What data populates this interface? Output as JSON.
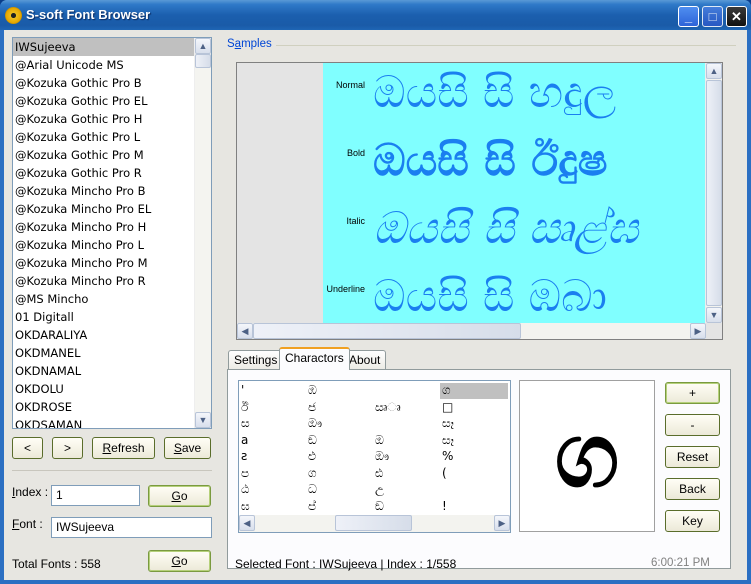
{
  "window": {
    "title": "S-soft Font Browser",
    "icon": "radiation-icon",
    "controls": {
      "minimize": "_",
      "maximize": "□",
      "close": "✕"
    }
  },
  "font_list": {
    "items": [
      "IWSujeeva",
      "@Arial Unicode MS",
      "@Kozuka Gothic Pro B",
      "@Kozuka Gothic Pro EL",
      "@Kozuka Gothic Pro H",
      "@Kozuka Gothic Pro L",
      "@Kozuka Gothic Pro M",
      "@Kozuka Gothic Pro R",
      "@Kozuka Mincho Pro B",
      "@Kozuka Mincho Pro EL",
      "@Kozuka Mincho Pro H",
      "@Kozuka Mincho Pro L",
      "@Kozuka Mincho Pro M",
      "@Kozuka Mincho Pro R",
      "@MS Mincho",
      "01 Digitall",
      "OKDARALIYA",
      "OKDMANEL",
      "OKDNAMAL",
      "OKDOLU",
      "OKDROSE",
      "OKDSAMAN"
    ],
    "selected_index": 0
  },
  "nav_buttons": {
    "prev": "<",
    "next": ">",
    "refresh": {
      "accel": "R",
      "rest": "efresh"
    },
    "save": {
      "accel": "S",
      "rest": "ave"
    }
  },
  "index_field": {
    "label_accel": "I",
    "label_rest": "ndex :",
    "value": "1",
    "go": {
      "accel": "G",
      "rest": "o"
    }
  },
  "font_field": {
    "label_accel": "F",
    "label_rest": "ont :",
    "value": "IWSujeeva"
  },
  "total": {
    "label": "Total Fonts : 558",
    "go": {
      "accel": "G",
      "rest": "o"
    }
  },
  "samples": {
    "title_pre": "S",
    "title_accel": "a",
    "title_post": "mples",
    "rows": [
      {
        "label": "Normal",
        "text": "ඔයසි  සි  හදුල"
      },
      {
        "label": "Bold",
        "text": "ඔයසි  සි  ඊදුෂ"
      },
      {
        "label": "Italic",
        "text": "ඔයසි  සි  ඍළ්ඝ"
      },
      {
        "label": "Underline",
        "text": "ඔයසි  සි  ඹබා"
      }
    ]
  },
  "tabs": [
    {
      "label": "Settings",
      "active": false
    },
    {
      "label": "Charactors",
      "active": true
    },
    {
      "label": "About",
      "active": false
    }
  ],
  "characters": {
    "columns": [
      [
        "'",
        "ඊ",
        "ස",
        "a",
        "ƨ",
        "ප",
        "ඨ",
        "ඝ"
      ],
      [
        "ඹ",
        "ජ",
        "ඖ",
        "ඞ",
        "ඵ",
        "ග",
        "ධ",
        "ප්"
      ],
      [
        "",
        "ඍෘ",
        "",
        "ඔ",
        "ඖ",
        "ඪ",
        "උ",
        "ඞ"
      ],
      [
        "ග",
        "□",
        "සෑ",
        "සෑ",
        "%",
        "(",
        "",
        "!"
      ]
    ],
    "selected": {
      "col": 3,
      "row": 0
    },
    "preview_char": "ග"
  },
  "preview_buttons": [
    "+",
    "-",
    "Reset",
    "Back",
    "Key"
  ],
  "status": {
    "text": "Selected Font :  IWSujeeva  |  Index : 1/558",
    "time": "6:00:21 PM"
  }
}
